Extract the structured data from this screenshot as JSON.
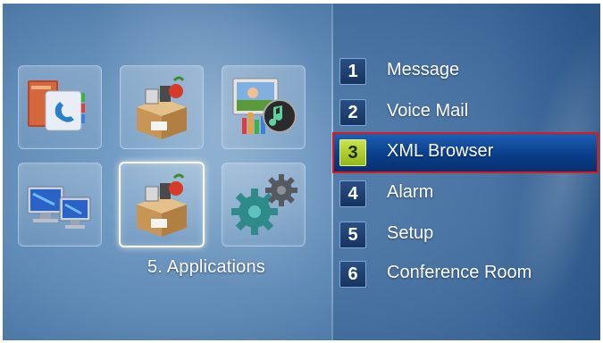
{
  "apps": {
    "caption": "5. Applications",
    "tiles": [
      {
        "icon": "phonebook-icon"
      },
      {
        "icon": "package-icon"
      },
      {
        "icon": "multimedia-icon"
      },
      {
        "icon": "network-computers-icon"
      },
      {
        "icon": "applications-package-icon",
        "selected": true
      },
      {
        "icon": "settings-gears-icon"
      }
    ]
  },
  "menu": {
    "items": [
      {
        "number": "1",
        "label": "Message"
      },
      {
        "number": "2",
        "label": "Voice Mail"
      },
      {
        "number": "3",
        "label": "XML Browser",
        "selected": true
      },
      {
        "number": "4",
        "label": "Alarm"
      },
      {
        "number": "5",
        "label": "Setup"
      },
      {
        "number": "6",
        "label": "Conference Room"
      }
    ]
  },
  "colors": {
    "highlight": "#0a3f8a",
    "selection_border": "#e01818",
    "selected_badge": "#b3d231",
    "badge": "#1f4270"
  }
}
